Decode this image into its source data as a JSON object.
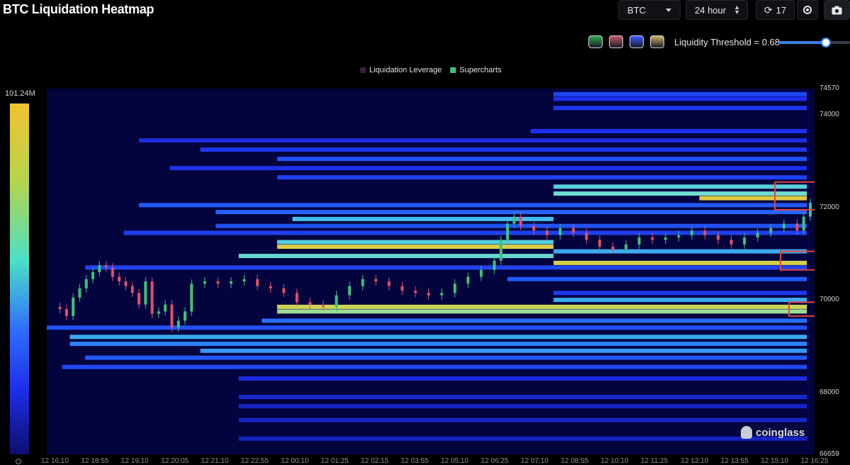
{
  "header": {
    "title": "BTC Liquidation Heatmap",
    "symbol": "BTC",
    "interval": "24 hour",
    "refresh_count": "17"
  },
  "threshold": {
    "label": "Liquidity Threshold = 0.68",
    "value": 0.68
  },
  "palettes": [
    "#2fa84a",
    "#c2576b",
    "#3a5bff",
    "#c9b36a"
  ],
  "legend": {
    "items": [
      {
        "label": "Liquidation Leverage",
        "color": "#3b1f4a"
      },
      {
        "label": "Supercharts",
        "color": "#3ec27a"
      }
    ]
  },
  "color_scale": {
    "max_label": "101.24M"
  },
  "y_axis": {
    "ticks": [
      {
        "label": "74570",
        "value": 74570
      },
      {
        "label": "74000",
        "value": 74000
      },
      {
        "label": "72000",
        "value": 72000
      },
      {
        "label": "70000",
        "value": 70000
      },
      {
        "label": "68000",
        "value": 68000
      },
      {
        "label": "66659",
        "value": 66659
      }
    ]
  },
  "x_axis": {
    "ticks": [
      "12 16:10",
      "12 18:55",
      "12 19:10",
      "12 20:05",
      "12 21:10",
      "12 22:55",
      "12 00:10",
      "12 01:25",
      "12 02:15",
      "12 03:55",
      "12 05:10",
      "12 06:25",
      "12 07:10",
      "12 08:55",
      "12 10:10",
      "12 11:25",
      "12 12:10",
      "12 13:55",
      "12 15:10",
      "12 16:25"
    ]
  },
  "watermark": "coinglass",
  "chart_data": {
    "type": "heatmap",
    "title": "BTC Liquidation Heatmap",
    "ylim": [
      66659,
      74570
    ],
    "color_scale_max": "101.24M",
    "price_series": {
      "name": "BTC price",
      "points": [
        [
          0,
          69850
        ],
        [
          2,
          69800
        ],
        [
          3,
          69650
        ],
        [
          4,
          70050
        ],
        [
          5,
          70250
        ],
        [
          6,
          70450
        ],
        [
          7,
          70600
        ],
        [
          8,
          70750
        ],
        [
          9,
          70700
        ],
        [
          10,
          70500
        ],
        [
          11,
          70400
        ],
        [
          12,
          70300
        ],
        [
          13,
          70150
        ],
        [
          14,
          69900
        ],
        [
          15,
          70400
        ],
        [
          16,
          69700
        ],
        [
          17,
          69750
        ],
        [
          18,
          69900
        ],
        [
          19,
          69400
        ],
        [
          20,
          69550
        ],
        [
          21,
          69750
        ],
        [
          22,
          70350
        ],
        [
          24,
          70400
        ],
        [
          26,
          70350
        ],
        [
          28,
          70400
        ],
        [
          30,
          70450
        ],
        [
          32,
          70300
        ],
        [
          34,
          70250
        ],
        [
          36,
          70150
        ],
        [
          38,
          69950
        ],
        [
          40,
          69900
        ],
        [
          42,
          69850
        ],
        [
          44,
          70100
        ],
        [
          46,
          70300
        ],
        [
          48,
          70450
        ],
        [
          50,
          70400
        ],
        [
          52,
          70300
        ],
        [
          54,
          70200
        ],
        [
          56,
          70150
        ],
        [
          58,
          70100
        ],
        [
          60,
          70150
        ],
        [
          62,
          70350
        ],
        [
          64,
          70500
        ],
        [
          66,
          70650
        ],
        [
          68,
          70850
        ],
        [
          69,
          71300
        ],
        [
          70,
          71650
        ],
        [
          71,
          71800
        ],
        [
          72,
          71600
        ],
        [
          74,
          71500
        ],
        [
          76,
          71400
        ],
        [
          78,
          71550
        ],
        [
          80,
          71450
        ],
        [
          82,
          71300
        ],
        [
          84,
          71150
        ],
        [
          86,
          71100
        ],
        [
          88,
          71200
        ],
        [
          90,
          71350
        ],
        [
          92,
          71300
        ],
        [
          94,
          71350
        ],
        [
          96,
          71400
        ],
        [
          98,
          71500
        ],
        [
          100,
          71400
        ],
        [
          102,
          71300
        ],
        [
          104,
          71200
        ],
        [
          106,
          71350
        ],
        [
          108,
          71450
        ],
        [
          110,
          71550
        ],
        [
          112,
          71650
        ],
        [
          114,
          71500
        ],
        [
          115,
          71800
        ],
        [
          116,
          72100
        ]
      ]
    },
    "bands": [
      {
        "price": 74450,
        "start": 66,
        "end": 99,
        "level": 0.25
      },
      {
        "price": 74350,
        "start": 66,
        "end": 99,
        "level": 0.2
      },
      {
        "price": 74150,
        "start": 66,
        "end": 99,
        "level": 0.22
      },
      {
        "price": 73650,
        "start": 63,
        "end": 99,
        "level": 0.2
      },
      {
        "price": 73450,
        "start": 12,
        "end": 99,
        "level": 0.18
      },
      {
        "price": 73250,
        "start": 20,
        "end": 99,
        "level": 0.22
      },
      {
        "price": 73050,
        "start": 30,
        "end": 99,
        "level": 0.28
      },
      {
        "price": 72850,
        "start": 16,
        "end": 99,
        "level": 0.2
      },
      {
        "price": 72650,
        "start": 30,
        "end": 99,
        "level": 0.24
      },
      {
        "price": 72450,
        "start": 66,
        "end": 99,
        "level": 0.55
      },
      {
        "price": 72300,
        "start": 66,
        "end": 99,
        "level": 0.62
      },
      {
        "price": 72200,
        "start": 85,
        "end": 99,
        "level": 0.9
      },
      {
        "price": 72050,
        "start": 12,
        "end": 99,
        "level": 0.3
      },
      {
        "price": 71900,
        "start": 22,
        "end": 99,
        "level": 0.32
      },
      {
        "price": 71750,
        "start": 32,
        "end": 66,
        "level": 0.48
      },
      {
        "price": 71600,
        "start": 22,
        "end": 99,
        "level": 0.28
      },
      {
        "price": 71450,
        "start": 10,
        "end": 99,
        "level": 0.24
      },
      {
        "price": 71250,
        "start": 30,
        "end": 66,
        "level": 0.55
      },
      {
        "price": 71150,
        "start": 30,
        "end": 66,
        "level": 0.88
      },
      {
        "price": 71050,
        "start": 66,
        "end": 99,
        "level": 0.45
      },
      {
        "price": 70950,
        "start": 25,
        "end": 66,
        "level": 0.6
      },
      {
        "price": 70800,
        "start": 66,
        "end": 99,
        "level": 0.86
      },
      {
        "price": 70700,
        "start": 5,
        "end": 99,
        "level": 0.25
      },
      {
        "price": 70450,
        "start": 60,
        "end": 99,
        "level": 0.3
      },
      {
        "price": 70150,
        "start": 66,
        "end": 99,
        "level": 0.22
      },
      {
        "price": 70000,
        "start": 66,
        "end": 99,
        "level": 0.45
      },
      {
        "price": 69850,
        "start": 30,
        "end": 99,
        "level": 0.82
      },
      {
        "price": 69750,
        "start": 30,
        "end": 99,
        "level": 0.72
      },
      {
        "price": 69550,
        "start": 28,
        "end": 99,
        "level": 0.35
      },
      {
        "price": 69400,
        "start": 0,
        "end": 99,
        "level": 0.28
      },
      {
        "price": 69200,
        "start": 3,
        "end": 99,
        "level": 0.45
      },
      {
        "price": 69050,
        "start": 3,
        "end": 99,
        "level": 0.38
      },
      {
        "price": 68900,
        "start": 20,
        "end": 99,
        "level": 0.42
      },
      {
        "price": 68750,
        "start": 5,
        "end": 99,
        "level": 0.3
      },
      {
        "price": 68550,
        "start": 2,
        "end": 99,
        "level": 0.26
      },
      {
        "price": 68300,
        "start": 25,
        "end": 99,
        "level": 0.18
      },
      {
        "price": 67900,
        "start": 25,
        "end": 99,
        "level": 0.15
      },
      {
        "price": 67700,
        "start": 25,
        "end": 99,
        "level": 0.14
      },
      {
        "price": 67400,
        "start": 25,
        "end": 99,
        "level": 0.14
      },
      {
        "price": 67000,
        "start": 25,
        "end": 99,
        "level": 0.13
      }
    ]
  }
}
